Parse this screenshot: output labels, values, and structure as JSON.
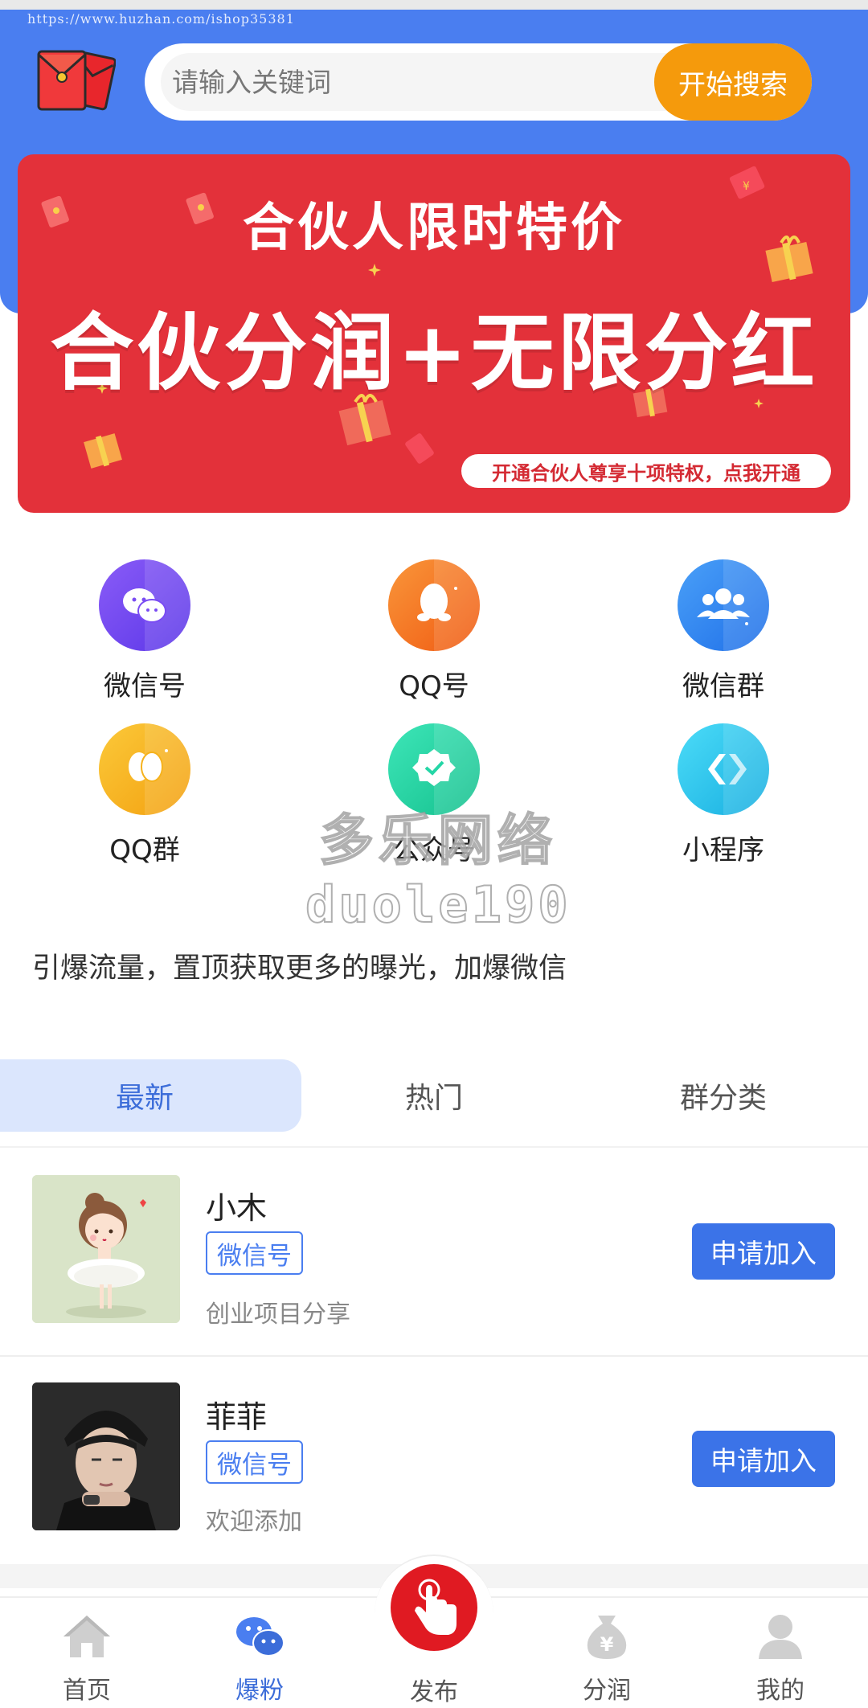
{
  "status": {
    "url_watermark": "https://www.huzhan.com/ishop35381"
  },
  "search": {
    "placeholder": "请输入关键词",
    "button_label": "开始搜索"
  },
  "banner": {
    "title": "合伙人限时特价",
    "headline": "合伙分润+无限分红",
    "cta": "开通合伙人尊享十项特权，点我开通",
    "colors": {
      "background": "#e3313a",
      "cta_text": "#d42a33"
    }
  },
  "categories": [
    {
      "label": "微信号",
      "icon": "wechat-icon",
      "color": "#7a4cf3"
    },
    {
      "label": "QQ号",
      "icon": "qq-penguin-icon",
      "color": "#f57a24"
    },
    {
      "label": "微信群",
      "icon": "group-icon",
      "color": "#2f8cf5"
    },
    {
      "label": "QQ群",
      "icon": "qq-group-icon",
      "color": "#f6b21c"
    },
    {
      "label": "公众号",
      "icon": "official-account-icon",
      "color": "#24d6a6"
    },
    {
      "label": "小程序",
      "icon": "mini-program-icon",
      "color": "#27c4ee"
    }
  ],
  "watermark": {
    "line1": "多乐网络",
    "line2": "duole190"
  },
  "slogan": "引爆流量，置顶获取更多的曝光，加爆微信",
  "tabs": [
    {
      "label": "最新",
      "active": true
    },
    {
      "label": "热门",
      "active": false
    },
    {
      "label": "群分类",
      "active": false
    }
  ],
  "list": [
    {
      "name": "小木",
      "tag": "微信号",
      "desc": "创业项目分享",
      "button": "申请加入",
      "avatar": "cartoon-ballerina-girl"
    },
    {
      "name": "菲菲",
      "tag": "微信号",
      "desc": "欢迎添加",
      "button": "申请加入",
      "avatar": "person-in-black-beanie"
    }
  ],
  "nav": [
    {
      "label": "首页",
      "icon": "home-icon",
      "active": false
    },
    {
      "label": "爆粉",
      "icon": "chat-bubbles-icon",
      "active": true
    },
    {
      "label": "发布",
      "icon": "tap-hand-icon",
      "active": false
    },
    {
      "label": "分润",
      "icon": "money-bag-icon",
      "active": false
    },
    {
      "label": "我的",
      "icon": "user-icon",
      "active": false
    }
  ],
  "colors": {
    "primary": "#4a7ef0",
    "accent": "#f59a0c",
    "apply_button": "#3b73e8",
    "publish_button": "#e01a22"
  }
}
